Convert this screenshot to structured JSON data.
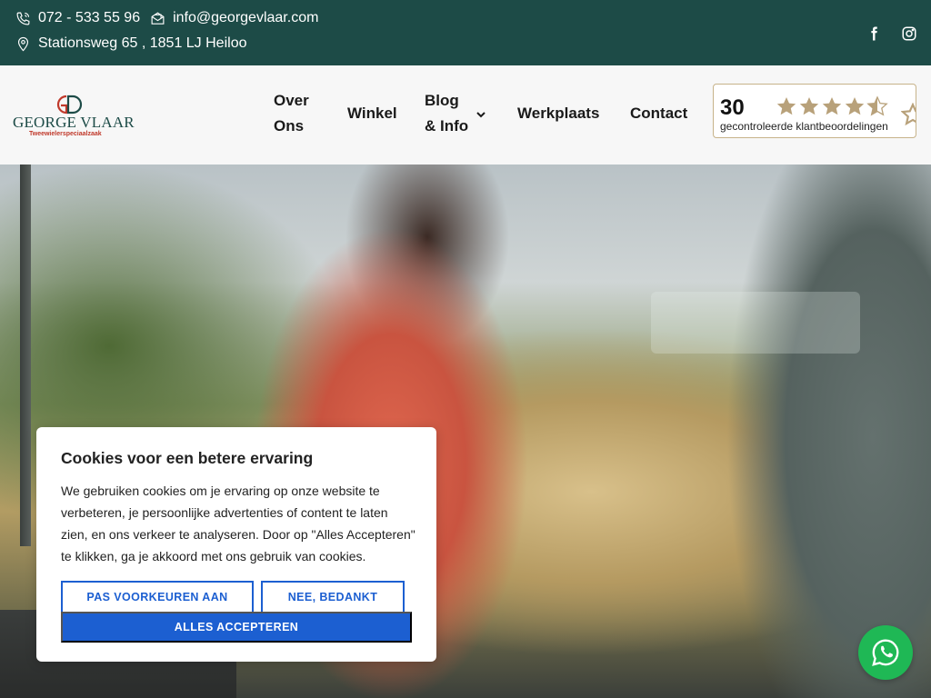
{
  "topbar": {
    "phone": "072 - 533 55 96",
    "email": "info@georgevlaar.com",
    "address": "Stationsweg 65 , 1851 LJ Heiloo",
    "icons": [
      "phone-icon",
      "mail-icon",
      "location-pin-icon",
      "facebook-icon",
      "instagram-icon"
    ],
    "background_color": "#1d4b47"
  },
  "logo": {
    "name": "GEORGE VLAAR",
    "tagline": "Tweewielerspeciaalzaak",
    "accent_color": "#c0392b"
  },
  "nav": {
    "about_line1": "Over",
    "about_line2": "Ons",
    "shop": "Winkel",
    "blog_line1": "Blog",
    "blog_line2": "& Info",
    "workshop": "Werkplaats",
    "contact": "Contact"
  },
  "rating": {
    "count": "30",
    "stars": 4.5,
    "label": "gecontroleerde klantbeoordelingen",
    "star_color": "#b8a17a"
  },
  "cookie": {
    "title": "Cookies voor een betere ervaring",
    "body": "We gebruiken cookies om je ervaring op onze website te verbeteren, je persoonlijke advertenties of content te laten zien, en ons verkeer te analyseren. Door op \"Alles Accepteren\" te klikken, ga je akkoord met ons gebruik van cookies.",
    "preferences_button": "PAS VOORKEUREN AAN",
    "decline_button": "NEE, BEDANKT",
    "accept_button": "ALLES ACCEPTEREN",
    "button_color": "#1c5fd1"
  },
  "whatsapp": {
    "icon": "whatsapp-icon",
    "color": "#1fb855"
  }
}
